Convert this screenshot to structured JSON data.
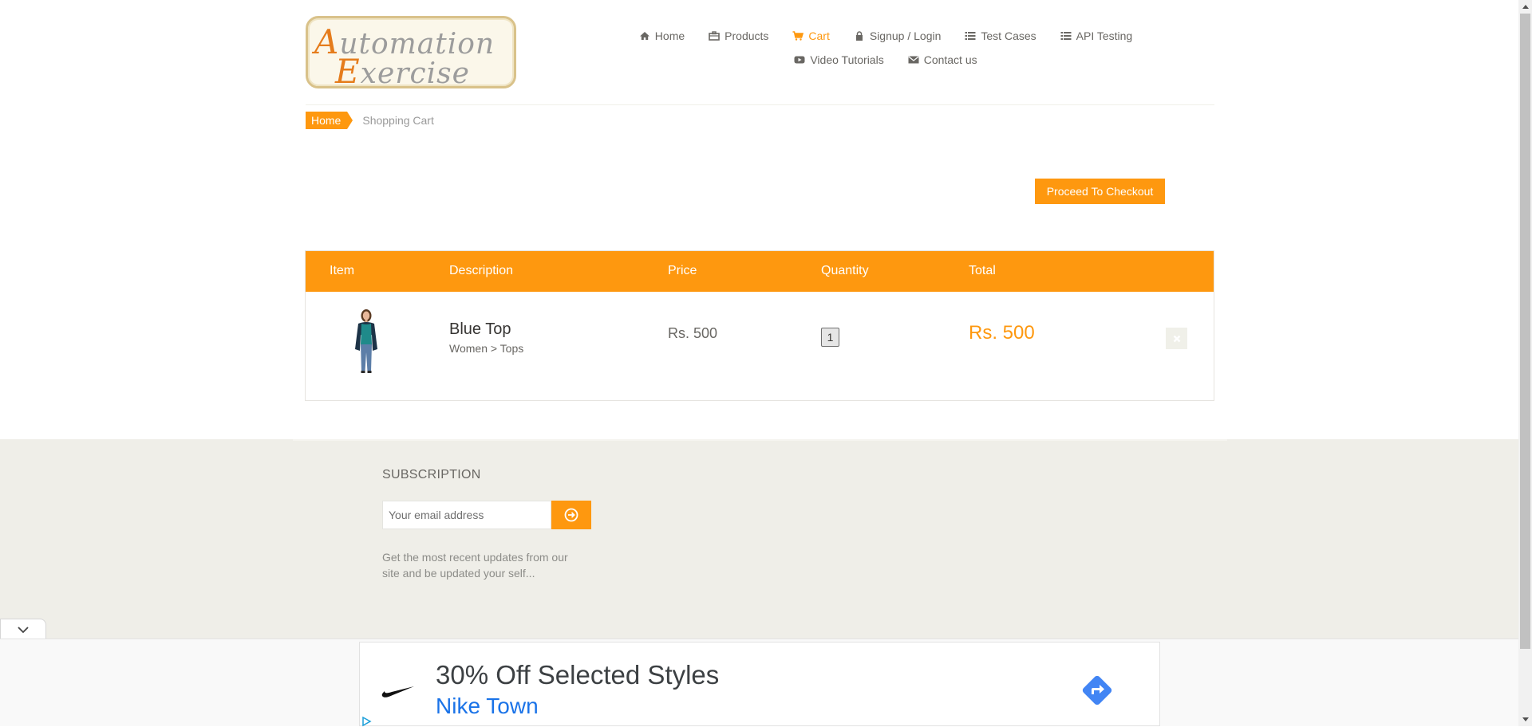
{
  "logo": {
    "line1_cap": "A",
    "line1_rest": "utomation",
    "line2_cap": "E",
    "line2_rest": "xercise"
  },
  "nav": {
    "row1": [
      {
        "label": "Home",
        "icon": "home-icon"
      },
      {
        "label": "Products",
        "icon": "products-icon"
      },
      {
        "label": "Cart",
        "icon": "cart-icon",
        "active": true
      },
      {
        "label": "Signup / Login",
        "icon": "lock-icon"
      },
      {
        "label": "Test Cases",
        "icon": "list-icon"
      },
      {
        "label": "API Testing",
        "icon": "list-icon"
      }
    ],
    "row2": [
      {
        "label": "Video Tutorials",
        "icon": "youtube-icon"
      },
      {
        "label": "Contact us",
        "icon": "envelope-icon"
      }
    ]
  },
  "breadcrumb": {
    "home": "Home",
    "current": "Shopping Cart"
  },
  "checkout_button": "Proceed To Checkout",
  "cart": {
    "headers": {
      "item": "Item",
      "description": "Description",
      "price": "Price",
      "quantity": "Quantity",
      "total": "Total"
    },
    "rows": [
      {
        "name": "Blue Top",
        "category": "Women > Tops",
        "price": "Rs. 500",
        "quantity": "1",
        "total": "Rs. 500"
      }
    ]
  },
  "subscription": {
    "title": "SUBSCRIPTION",
    "placeholder": "Your email address",
    "description": "Get the most recent updates from our site and be updated your self..."
  },
  "ad": {
    "title": "30% Off Selected Styles",
    "subtitle": "Nike Town"
  },
  "colors": {
    "accent": "#fe980f",
    "footer_bg": "#efeee8",
    "ad_link": "#1a73e8",
    "ad_direction": "#4285f4"
  }
}
